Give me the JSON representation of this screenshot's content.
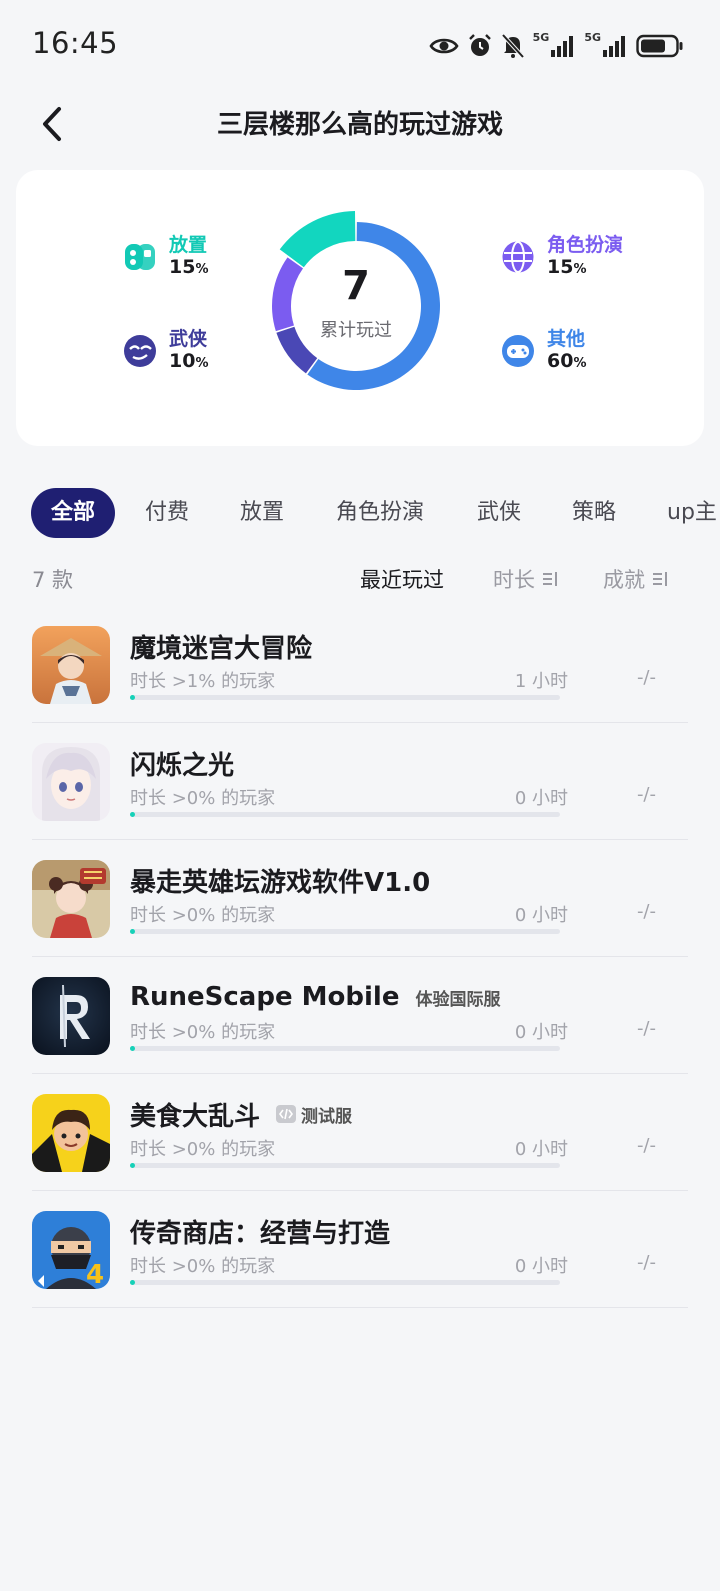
{
  "status_bar": {
    "time": "16:45",
    "sig1": "5G",
    "sig2": "5G"
  },
  "header": {
    "title": "三层楼那么高的玩过游戏"
  },
  "summary": {
    "count": "7",
    "caption": "累计玩过",
    "categories": [
      {
        "name": "放置",
        "pct": "15",
        "unit": "%",
        "color": "#12c9b5",
        "icon": "idle-gamepad-icon"
      },
      {
        "name": "武侠",
        "pct": "10",
        "unit": "%",
        "color": "#3e3c9a",
        "icon": "wuxia-mask-icon"
      },
      {
        "name": "角色扮演",
        "pct": "15",
        "unit": "%",
        "color": "#7b5cf0",
        "icon": "globe-icon"
      },
      {
        "name": "其他",
        "pct": "60",
        "unit": "%",
        "color": "#3f86e8",
        "icon": "gamepad-icon"
      }
    ],
    "donut_segments": [
      {
        "name": "其他",
        "fraction": 0.6,
        "color": "#3f86e8"
      },
      {
        "name": "武侠",
        "fraction": 0.1,
        "color": "#4a48b5"
      },
      {
        "name": "角色扮演",
        "fraction": 0.15,
        "color": "#7b5cf0"
      },
      {
        "name": "放置",
        "fraction": 0.15,
        "color": "#12d6bf"
      }
    ]
  },
  "tabs": [
    "全部",
    "付费",
    "放置",
    "角色扮演",
    "武侠",
    "策略",
    "up主"
  ],
  "list_header": {
    "count": "7 款",
    "sort_recent": "最近玩过",
    "sort_duration": "时长",
    "sort_achievement": "成就"
  },
  "games": [
    {
      "name": "魔境迷宫大冒险",
      "tag": "",
      "desc": "时长 >1% 的玩家",
      "hours": "1 小时",
      "achievement": "-/-",
      "progress": 0.01
    },
    {
      "name": "闪烁之光",
      "tag": "",
      "desc": "时长 >0% 的玩家",
      "hours": "0 小时",
      "achievement": "-/-",
      "progress": 0.0
    },
    {
      "name": "暴走英雄坛游戏软件V1.0",
      "tag": "",
      "desc": "时长 >0% 的玩家",
      "hours": "0 小时",
      "achievement": "-/-",
      "progress": 0.0
    },
    {
      "name": "RuneScape Mobile",
      "tag": "体验国际服",
      "desc": "时长 >0% 的玩家",
      "hours": "0 小时",
      "achievement": "-/-",
      "progress": 0.0
    },
    {
      "name": "美食大乱斗",
      "tag": "测试服",
      "desc": "时长 >0% 的玩家",
      "hours": "0 小时",
      "achievement": "-/-",
      "progress": 0.0
    },
    {
      "name": "传奇商店：经营与打造",
      "tag": "",
      "desc": "时长 >0% 的玩家",
      "hours": "0 小时",
      "achievement": "-/-",
      "progress": 0.0
    }
  ]
}
